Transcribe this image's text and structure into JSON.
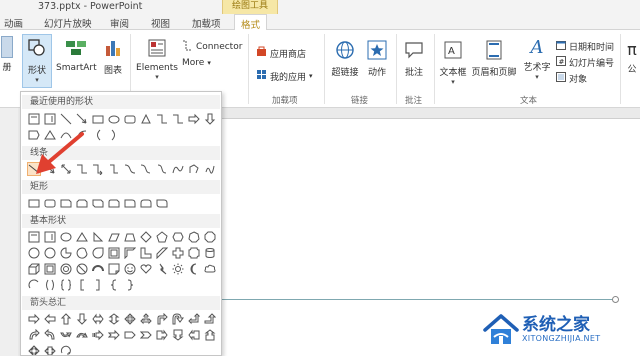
{
  "window": {
    "title": "373.pptx - PowerPoint",
    "context_header": "绘图工具"
  },
  "tabs": [
    {
      "label": "动画"
    },
    {
      "label": "幻灯片放映"
    },
    {
      "label": "审阅"
    },
    {
      "label": "视图"
    },
    {
      "label": "加载项"
    },
    {
      "label": "格式",
      "active": true
    }
  ],
  "ribbon": {
    "cut_label": "册",
    "shapes_label": "形状",
    "smartart_label": "SmartArt",
    "chart_label": "图表",
    "elements_label": "Elements",
    "connector_label": "Connector",
    "more_label": "More",
    "app_store_label": "应用商店",
    "my_apps_label": "我的应用",
    "addins_group": "加载项",
    "hyperlink_label": "超链接",
    "action_label": "动作",
    "links_group": "链接",
    "comment_label": "批注",
    "comments_group": "批注",
    "textbox_label": "文本框",
    "header_footer_label": "页眉和页脚",
    "wordart_label": "艺术字",
    "datetime_label": "日期和时间",
    "slide_number_label": "幻灯片编号",
    "object_label": "对象",
    "text_group": "文本",
    "formula_label": "公"
  },
  "shapes_panel": {
    "recent_header": "最近使用的形状",
    "lines_header": "线条",
    "rect_header": "矩形",
    "basic_header": "基本形状",
    "arrows_header": "箭头总汇"
  },
  "watermark": {
    "name": "系统之家",
    "url": "XITONGZHIJIA.NET"
  },
  "colors": {
    "accent": "#b58c1a",
    "context_tab": "#f6e7a6",
    "selection": "#d5e8f7",
    "pointer_arrow": "#e04030",
    "watermark_blue": "#1f5fb5"
  }
}
